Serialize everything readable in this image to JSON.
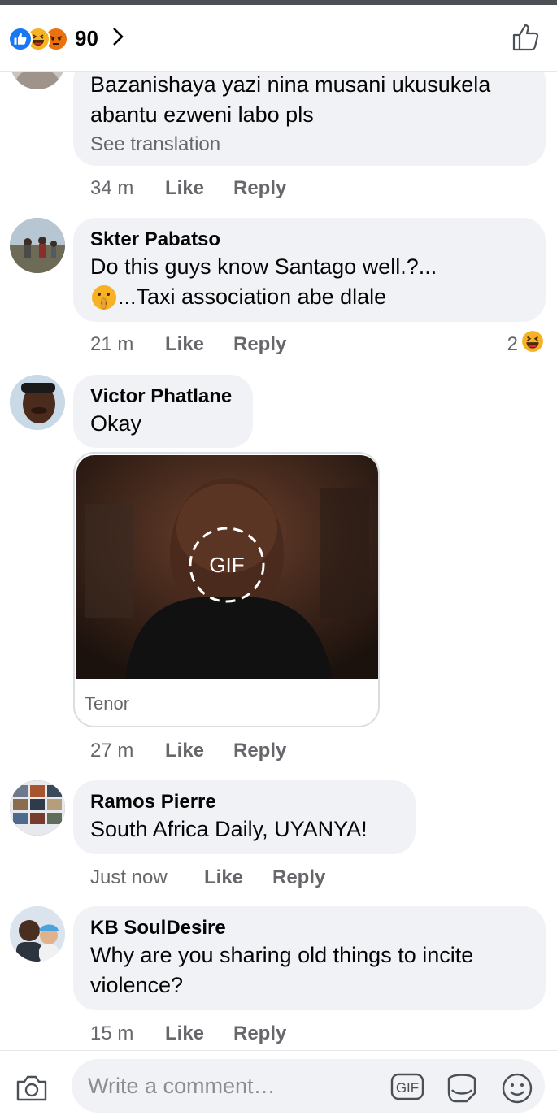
{
  "header": {
    "reaction_count": "90",
    "reactions": [
      "like-icon",
      "haha-icon",
      "angry-icon"
    ]
  },
  "comments": [
    {
      "author": "",
      "text_lines": [
        "Bazanishaya yazi nina musani ukusukela",
        "abantu ezweni labo pls"
      ],
      "see_translation": "See translation",
      "time": "34 m",
      "like": "Like",
      "reply": "Reply"
    },
    {
      "author": "Skter Pabatso",
      "text_lines": [
        "Do this guys know Santago well.?...",
        "...Taxi association abe dlale"
      ],
      "time": "21 m",
      "like": "Like",
      "reply": "Reply",
      "reaction_count": "2"
    },
    {
      "author": "Victor Phatlane",
      "text_lines": [
        "Okay"
      ],
      "gif_badge": "GIF",
      "gif_source": "Tenor",
      "time": "27 m",
      "like": "Like",
      "reply": "Reply"
    },
    {
      "author": "Ramos Pierre",
      "text_lines": [
        "South Africa Daily, UYANYA!"
      ],
      "time": "Just now",
      "like": "Like",
      "reply": "Reply"
    },
    {
      "author": "KB SoulDesire",
      "text_lines": [
        "Why are you sharing old things to incite",
        "violence?"
      ],
      "time": "15 m",
      "like": "Like",
      "reply": "Reply"
    }
  ],
  "composer": {
    "placeholder": "Write a comment…",
    "gif_label": "GIF"
  },
  "colors": {
    "bubble": "#f0f2f5",
    "secondary_text": "#65676b",
    "like_blue": "#1877f2"
  }
}
